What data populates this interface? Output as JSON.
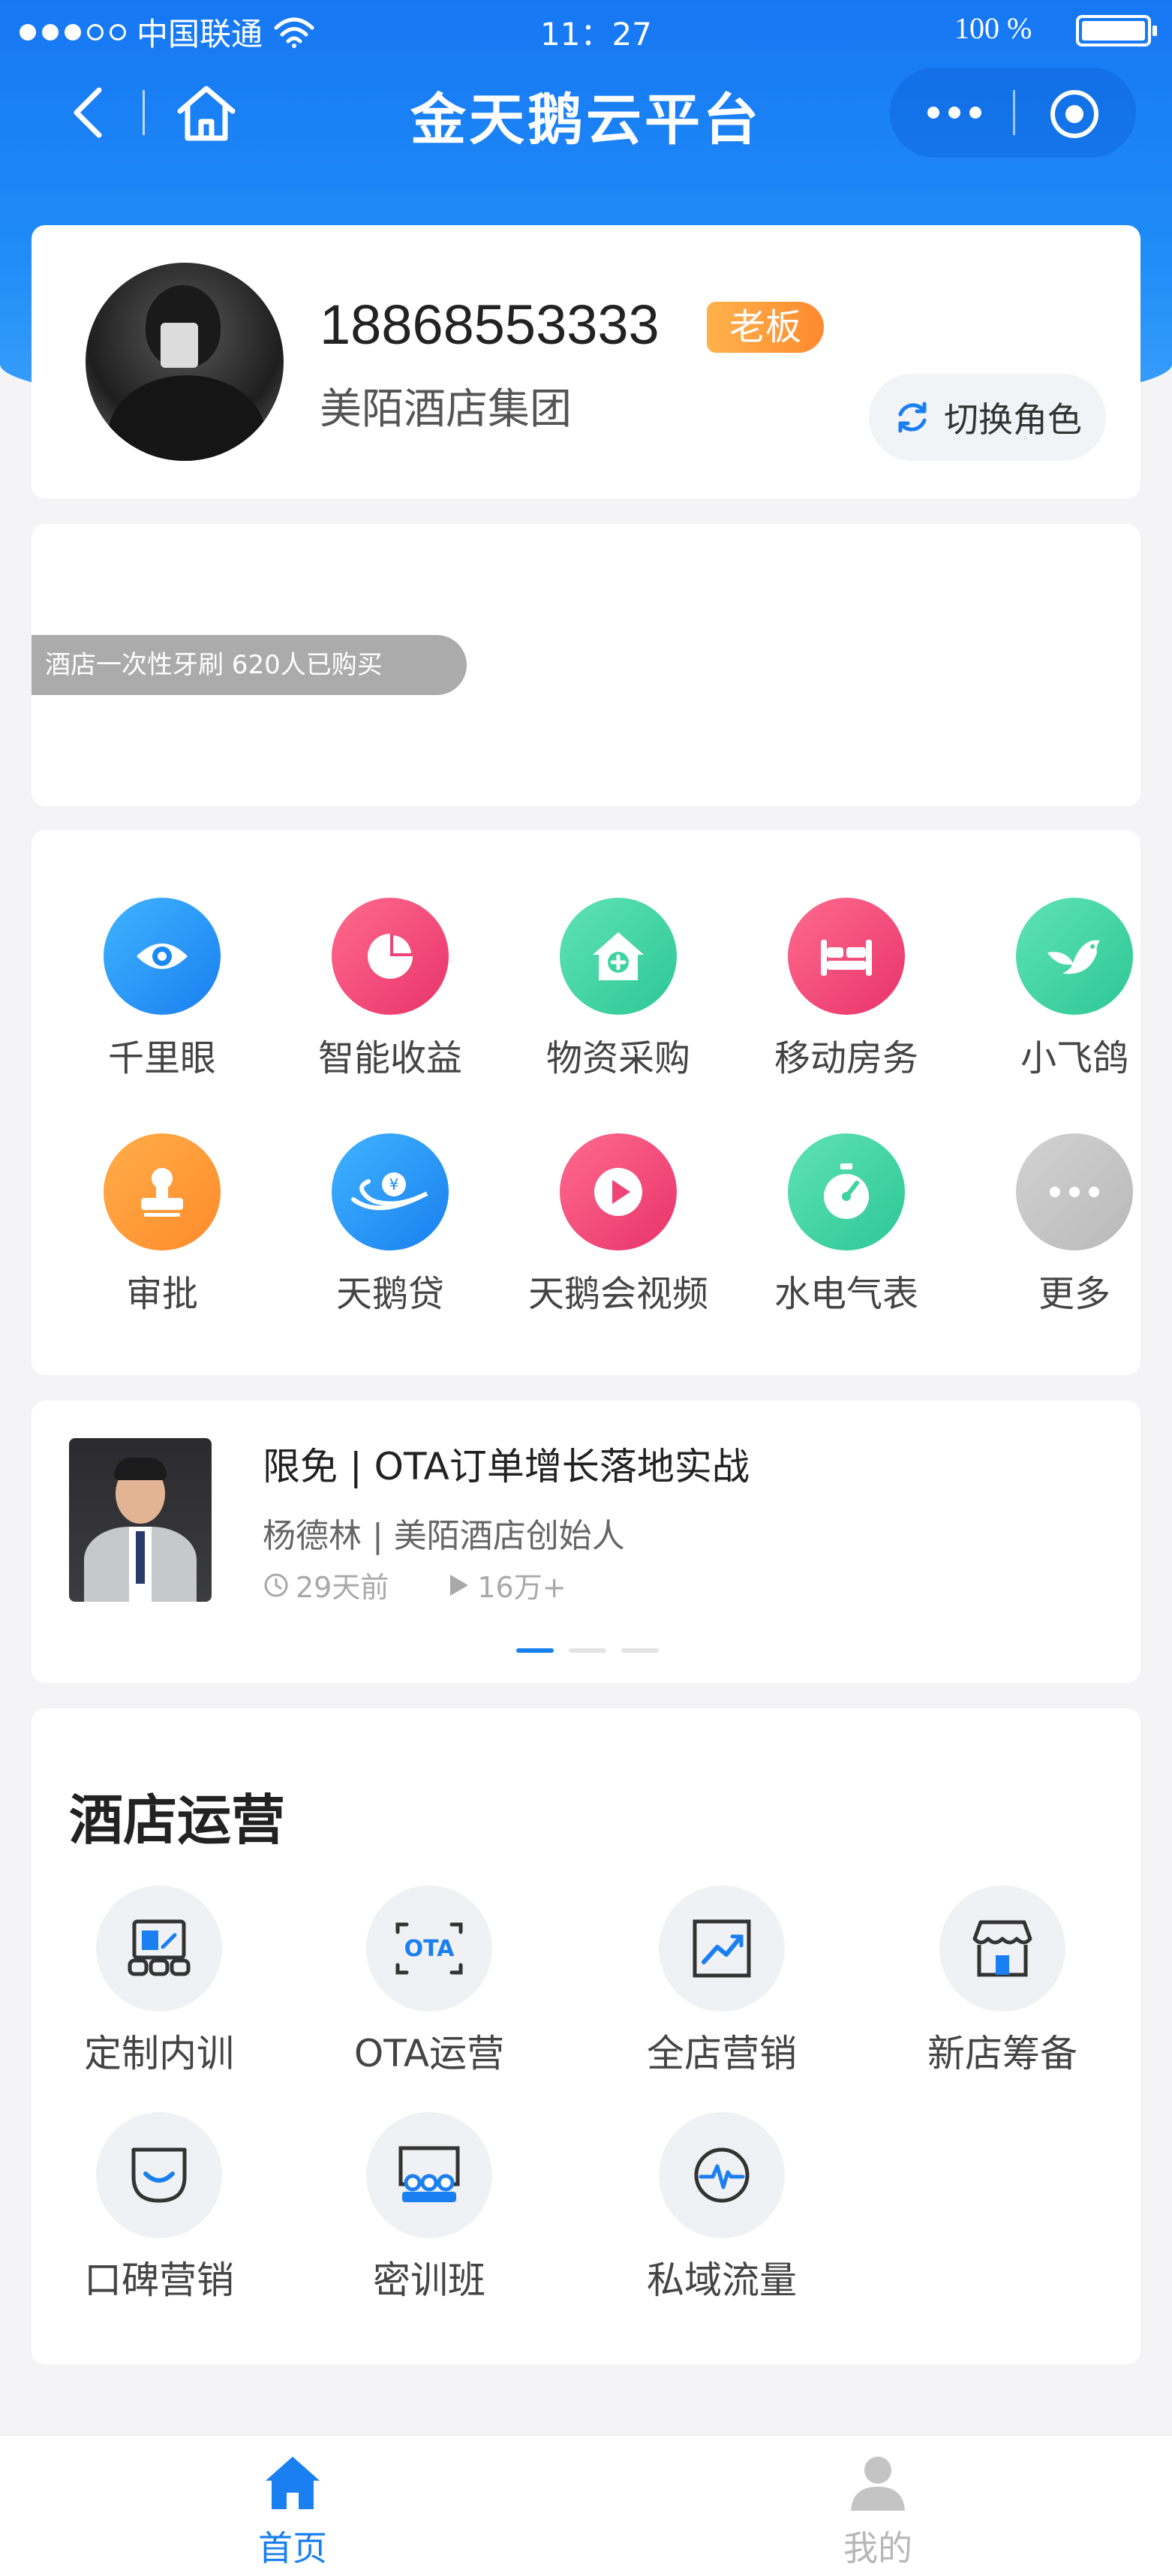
{
  "status_bar": {
    "carrier": "中国联通",
    "time": "11：27",
    "battery": "100 %"
  },
  "nav": {
    "title": "金天鹅云平台",
    "back_icon": "chevron-left-icon",
    "home_icon": "home-icon"
  },
  "profile": {
    "phone": "18868553333",
    "role": "老板",
    "company": "美陌酒店集团",
    "switch_label": "切换角色"
  },
  "promo": {
    "ticker": "酒店一次性牙刷   620人已购买"
  },
  "apps": [
    {
      "label": "千里眼",
      "icon": "eye-icon",
      "color": "blue"
    },
    {
      "label": "智能收益",
      "icon": "pie-chart-icon",
      "color": "pink"
    },
    {
      "label": "物资采购",
      "icon": "house-plus-icon",
      "color": "green"
    },
    {
      "label": "移动房务",
      "icon": "bed-icon",
      "color": "pink"
    },
    {
      "label": "小飞鸽",
      "icon": "bird-icon",
      "color": "green"
    },
    {
      "label": "审批",
      "icon": "stamp-icon",
      "color": "orange"
    },
    {
      "label": "天鹅贷",
      "icon": "swan-loan-icon",
      "color": "blue"
    },
    {
      "label": "天鹅会视频",
      "icon": "play-icon",
      "color": "pink"
    },
    {
      "label": "水电气表",
      "icon": "meter-icon",
      "color": "green"
    },
    {
      "label": "更多",
      "icon": "more-icon",
      "color": "gray"
    }
  ],
  "course": {
    "title": "限免 | OTA订单增长落地实战",
    "author": "杨德林 | 美陌酒店创始人",
    "time": "29天前",
    "views": "16万+"
  },
  "operations": {
    "title": "酒店运营",
    "items": [
      {
        "label": "定制内训",
        "icon": "training-icon"
      },
      {
        "label": "OTA运营",
        "icon": "ota-icon"
      },
      {
        "label": "全店营销",
        "icon": "chart-trend-icon"
      },
      {
        "label": "新店筹备",
        "icon": "store-icon"
      },
      {
        "label": "口碑营销",
        "icon": "smile-chat-icon"
      },
      {
        "label": "密训班",
        "icon": "class-icon"
      },
      {
        "label": "私域流量",
        "icon": "pulse-icon"
      }
    ]
  },
  "tabbar": [
    {
      "label": "首页",
      "icon": "home-filled-icon",
      "active": true
    },
    {
      "label": "我的",
      "icon": "user-icon",
      "active": false
    }
  ],
  "colors": {
    "primary": "#1a7ff0",
    "badge": "#ff8a2e"
  }
}
